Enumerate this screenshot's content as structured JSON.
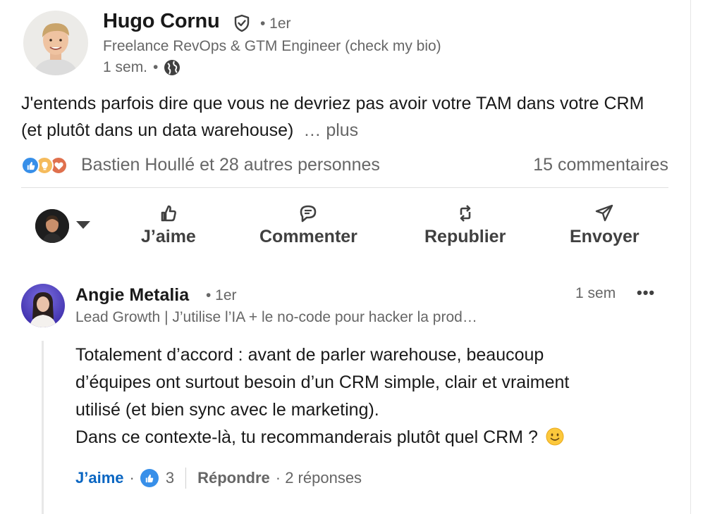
{
  "post": {
    "author_name": "Hugo Cornu",
    "author_degree": "• 1er",
    "author_headline": "Freelance RevOps & GTM Engineer (check my bio)",
    "time": "1 sem.",
    "time_separator": "•",
    "text": "J'entends parfois dire que vous ne devriez pas avoir votre TAM dans votre CRM (et plutôt dans un data warehouse)",
    "more_label": "… plus",
    "reactors_text": "Bastien Houllé et 28 autres personnes",
    "comments_count_text": "15 commentaires",
    "reaction_icons": [
      "like-icon",
      "idea-icon",
      "love-icon"
    ]
  },
  "actions": {
    "like": "J’aime",
    "comment": "Commenter",
    "repost": "Republier",
    "send": "Envoyer"
  },
  "comment": {
    "author_name": "Angie Metalia",
    "author_degree": "• 1er",
    "time": "1 sem",
    "more": "•••",
    "headline": "Lead Growth | J’utilise l’IA + le no-code pour hacker la prod…",
    "line1": "Totalement d’accord : avant de parler warehouse, beaucoup",
    "line2": "d’équipes ont surtout besoin d’un CRM simple, clair et vraiment",
    "line3": "utilisé (et bien sync avec le marketing).",
    "line4": "Dans ce contexte-là, tu recommanderais plutôt quel CRM ?",
    "like_label": "J’aime",
    "dot": "·",
    "like_count": "3",
    "reply_label": "Répondre",
    "replies_text": "· 2 réponses"
  },
  "colors": {
    "link_blue": "#0a66c2",
    "like_blue": "#378fe9",
    "muted_text": "#666666"
  }
}
